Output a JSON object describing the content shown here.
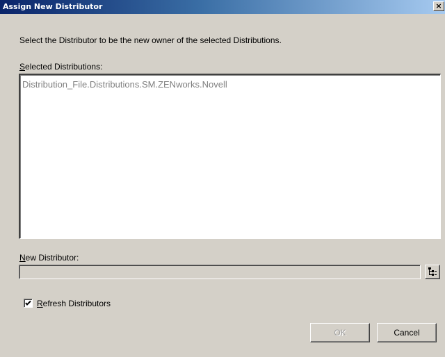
{
  "window": {
    "title": "Assign New Distributor",
    "close_label": "×"
  },
  "instruction": "Select the Distributor to be the new owner of the selected Distributions.",
  "selected_distributions": {
    "label_accel": "S",
    "label_rest": "elected Distributions:",
    "items": [
      "Distribution_File.Distributions.SM.ZENworks.Novell"
    ]
  },
  "new_distributor": {
    "label_accel": "N",
    "label_rest": "ew Distributor:",
    "value": ""
  },
  "refresh": {
    "checked": true,
    "label_accel": "R",
    "label_rest": "efresh Distributors"
  },
  "buttons": {
    "ok_label": "OK",
    "cancel_label": "Cancel"
  },
  "icons": {
    "browse": "tree-browse-icon",
    "check": "check-mark-icon",
    "close": "close-icon"
  }
}
